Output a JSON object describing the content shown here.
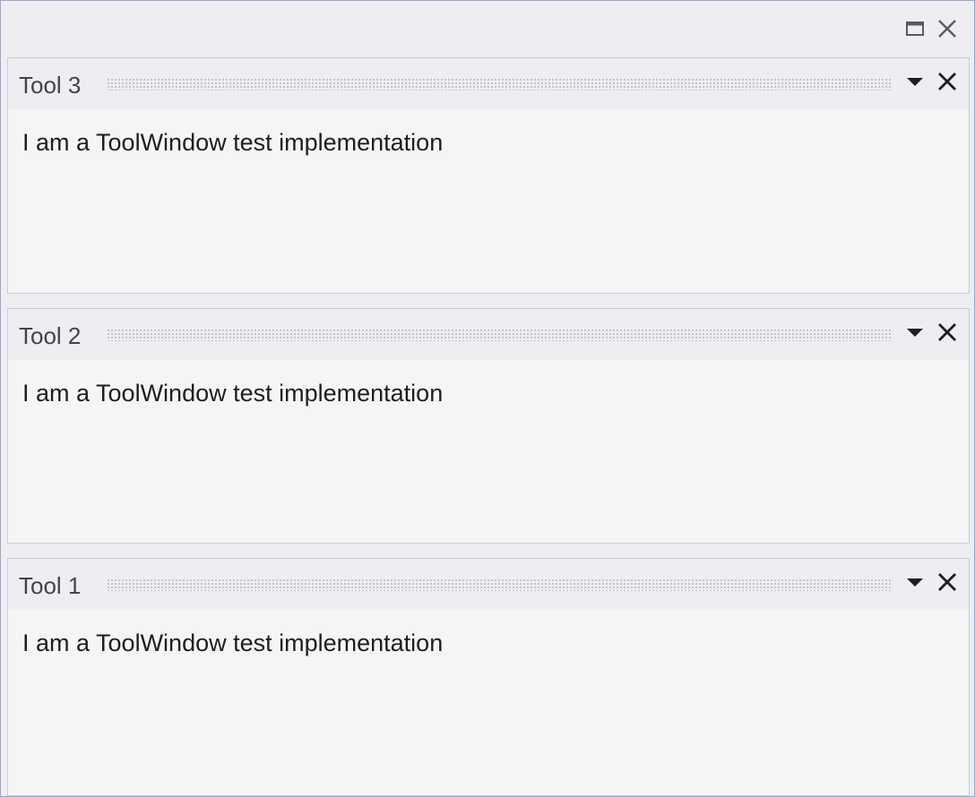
{
  "window": {
    "maximize_icon": "maximize-icon",
    "close_icon": "close-icon"
  },
  "panes": [
    {
      "title": "Tool 3",
      "content": "I am a ToolWindow test implementation",
      "dropdown_icon": "dropdown-arrow-icon",
      "close_icon": "close-icon"
    },
    {
      "title": "Tool 2",
      "content": "I am a ToolWindow test implementation",
      "dropdown_icon": "dropdown-arrow-icon",
      "close_icon": "close-icon"
    },
    {
      "title": "Tool 1",
      "content": "I am a ToolWindow test implementation",
      "dropdown_icon": "dropdown-arrow-icon",
      "close_icon": "close-icon"
    }
  ],
  "colors": {
    "chrome": "#eeeef2",
    "pane_body": "#f5f5f5",
    "border": "#9aa7c7",
    "text": "#1e1e1e",
    "title_text": "#444444"
  }
}
